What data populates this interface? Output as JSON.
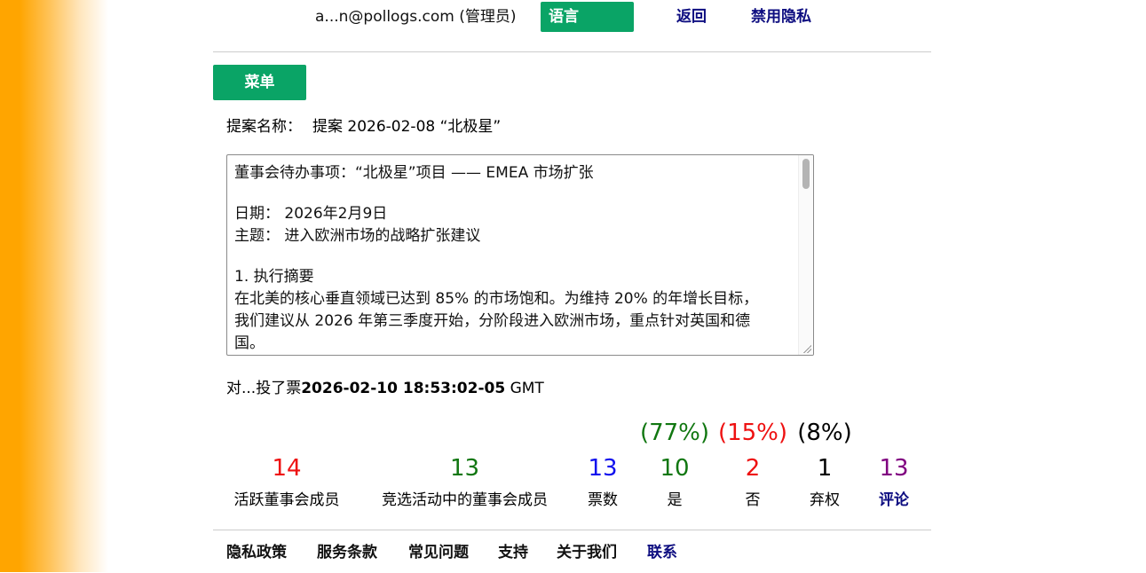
{
  "header": {
    "user": "a...n@pollogs.com (管理员)",
    "language_button": "语言",
    "back_link": "返回",
    "privacy_toggle": "禁用隐私"
  },
  "menu_button": "菜单",
  "proposal": {
    "label": "提案名称：",
    "name": "提案 2026-02-08 “北极星”",
    "text_lines": [
      "董事会待办事项：“北极星”项目 —— EMEA 市场扩张",
      "",
      "日期：  2026年2月9日",
      "主题：  进入欧洲市场的战略扩张建议",
      "",
      "1. 执行摘要",
      "在北美的核心垂直领域已达到 85% 的市场饱和。为维持 20% 的年增长目标，",
      "我们建议从 2026 年第三季度开始，分阶段进入欧洲市场，重点针对英国和德",
      "国。"
    ]
  },
  "vote_info": {
    "prefix": "对...投了票",
    "timestamp": "2026-02-10 18:53:02-05",
    "tz": " GMT"
  },
  "stats": {
    "active_members": {
      "value": "14",
      "label": "活跃董事会成员"
    },
    "campaign_members": {
      "value": "13",
      "label": "竞选活动中的董事会成员"
    },
    "votes": {
      "value": "13",
      "label": "票数"
    },
    "yes": {
      "value": "10",
      "label": "是",
      "pct": "(77%)"
    },
    "no": {
      "value": "2",
      "label": "否",
      "pct": "(15%)"
    },
    "abstain": {
      "value": "1",
      "label": "弃权",
      "pct": "(8%)"
    },
    "comments": {
      "value": "13",
      "label": "评论"
    }
  },
  "footer": {
    "privacy": "隐私政策",
    "terms": "服务条款",
    "faq": "常见问题",
    "support": "支持",
    "about": "关于我们",
    "contact": "联系"
  },
  "colors": {
    "accent_green": "#0aa466",
    "link_navy": "#0d0d80",
    "sidebar_orange": "#ffa500"
  }
}
